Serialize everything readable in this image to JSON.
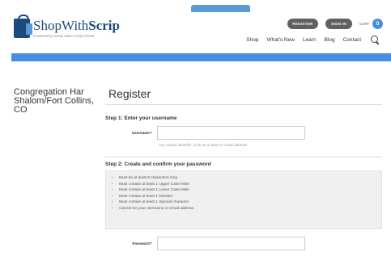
{
  "header": {
    "logo_title_prefix": "ShopWith",
    "logo_title_suffix": "Scrip",
    "logo_subtitle": "Powered by Great Lakes Scrip Center",
    "register_button": "REGISTER",
    "signin_button": "SIGN IN",
    "cart_label": "CART",
    "cart_count": "0",
    "nav": [
      "Shop",
      "What's New",
      "Learn",
      "Blog",
      "Contact"
    ]
  },
  "sidebar": {
    "org_name": "Congregation Har Shalom/Fort Collins, CO"
  },
  "main": {
    "title": "Register",
    "step1": {
      "title": "Step 1: Enter your username",
      "username_label": "Username:*",
      "username_value": "",
      "username_hint": "Any unique identifier, such as a name or email address"
    },
    "step2": {
      "title": "Step 2: Create and confirm your password",
      "rules": [
        "Must be at least 8 characters long",
        "Must contain at least 1 Upper Case letter",
        "Must contain at least 1 Lower Case letter",
        "Must contain at least 1 Number",
        "Must contain at least 1 Special character",
        "Cannot be your username or email address"
      ],
      "password_label": "Password:*",
      "password_value": ""
    }
  },
  "colors": {
    "brand_navy": "#1c4a7d",
    "accent_blue": "#4a90e2",
    "pill_gray": "#606060"
  }
}
